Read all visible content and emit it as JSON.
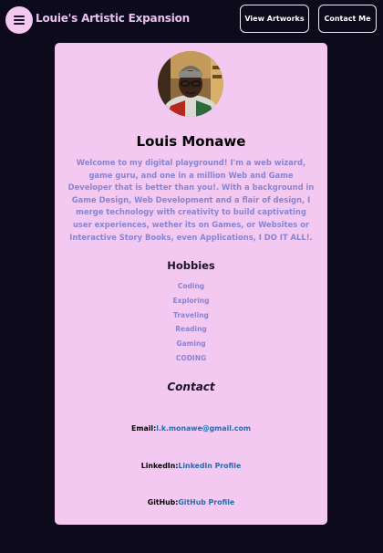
{
  "colors": {
    "background": "#0c0a1b",
    "card": "#f3c9f1",
    "accent_text": "#8a84cf",
    "link": "#1f6fb0"
  },
  "navbar": {
    "menu_icon": "hamburger-icon",
    "brand": "Louie's Artistic Expansion",
    "view_artworks_label": "View Artworks",
    "contact_me_label": "Contact Me"
  },
  "profile": {
    "name": "Louis Monawe",
    "bio": "Welcome to my digital playground! I'm a web wizard, game guru, and one in a million Web and Game Developer that is better than you!. With a background in Game Design, Web Development and a flair of design, I merge technology with creativity to build captivating user experiences, wether its on Games, or Websites or Interactive Story Books, even Applications, I DO IT ALL!."
  },
  "hobbies": {
    "title": "Hobbies",
    "items": [
      "Coding",
      "Exploring",
      "Traveling",
      "Reading",
      "Gaming",
      "CODING"
    ]
  },
  "contact": {
    "title": "Contact",
    "email_label": "Email:",
    "email_value": "l.k.monawe@gmail.com",
    "linkedin_label": "LinkedIn:",
    "linkedin_value": "LinkedIn Profile",
    "github_label": "GitHub:",
    "github_value": "GitHub Profile"
  }
}
